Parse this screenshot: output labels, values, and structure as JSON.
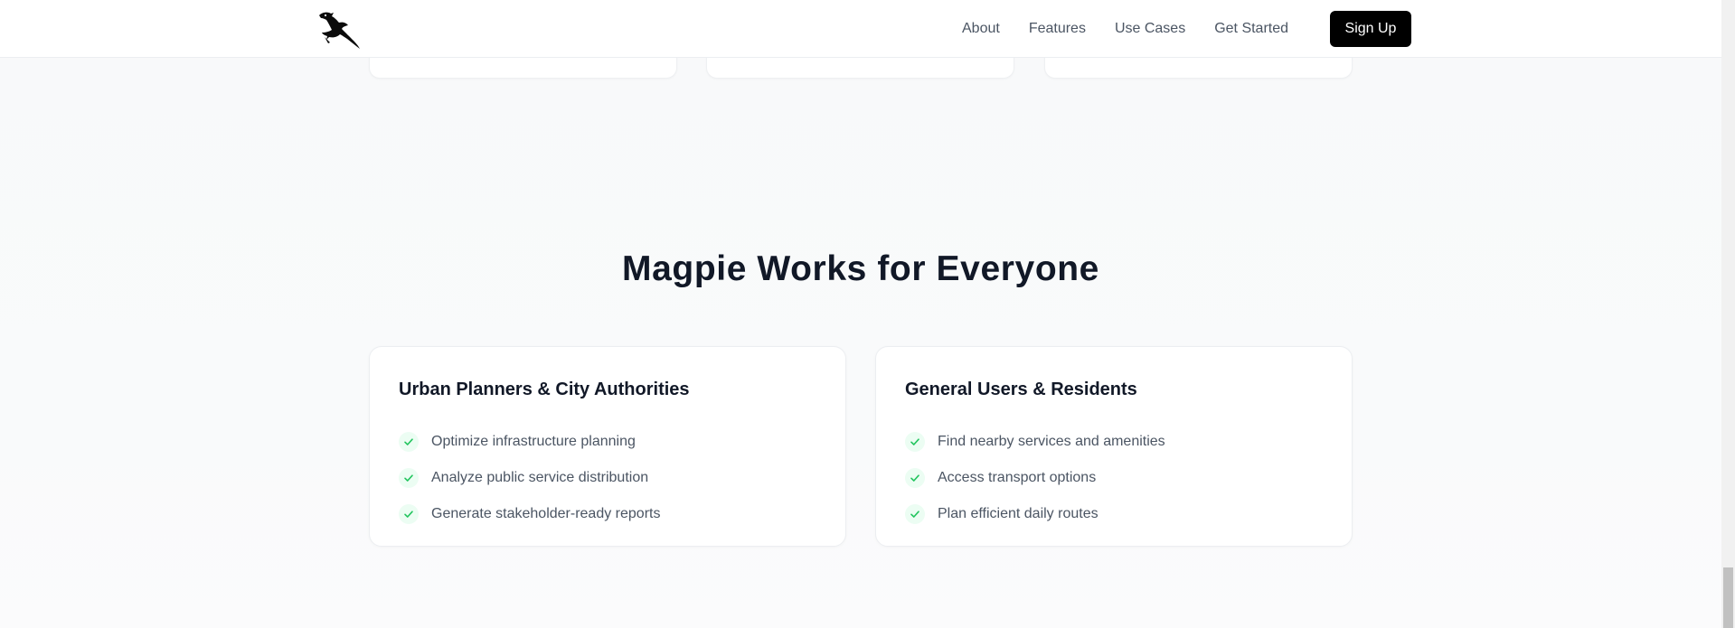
{
  "nav": {
    "logo_icon": "magpie-bird-logo",
    "links": [
      "About",
      "Features",
      "Use Cases",
      "Get Started"
    ],
    "signup_label": "Sign Up"
  },
  "section": {
    "title": "Magpie Works for Everyone"
  },
  "cards": [
    {
      "title": "Urban Planners & City Authorities",
      "items": [
        "Optimize infrastructure planning",
        "Analyze public service distribution",
        "Generate stakeholder-ready reports"
      ]
    },
    {
      "title": "General Users & Residents",
      "items": [
        "Find nearby services and amenities",
        "Access transport options",
        "Plan efficient daily routes"
      ]
    }
  ],
  "colors": {
    "accent": "#000000",
    "check": "#22c55e",
    "check_bg": "#ecfdf3"
  }
}
